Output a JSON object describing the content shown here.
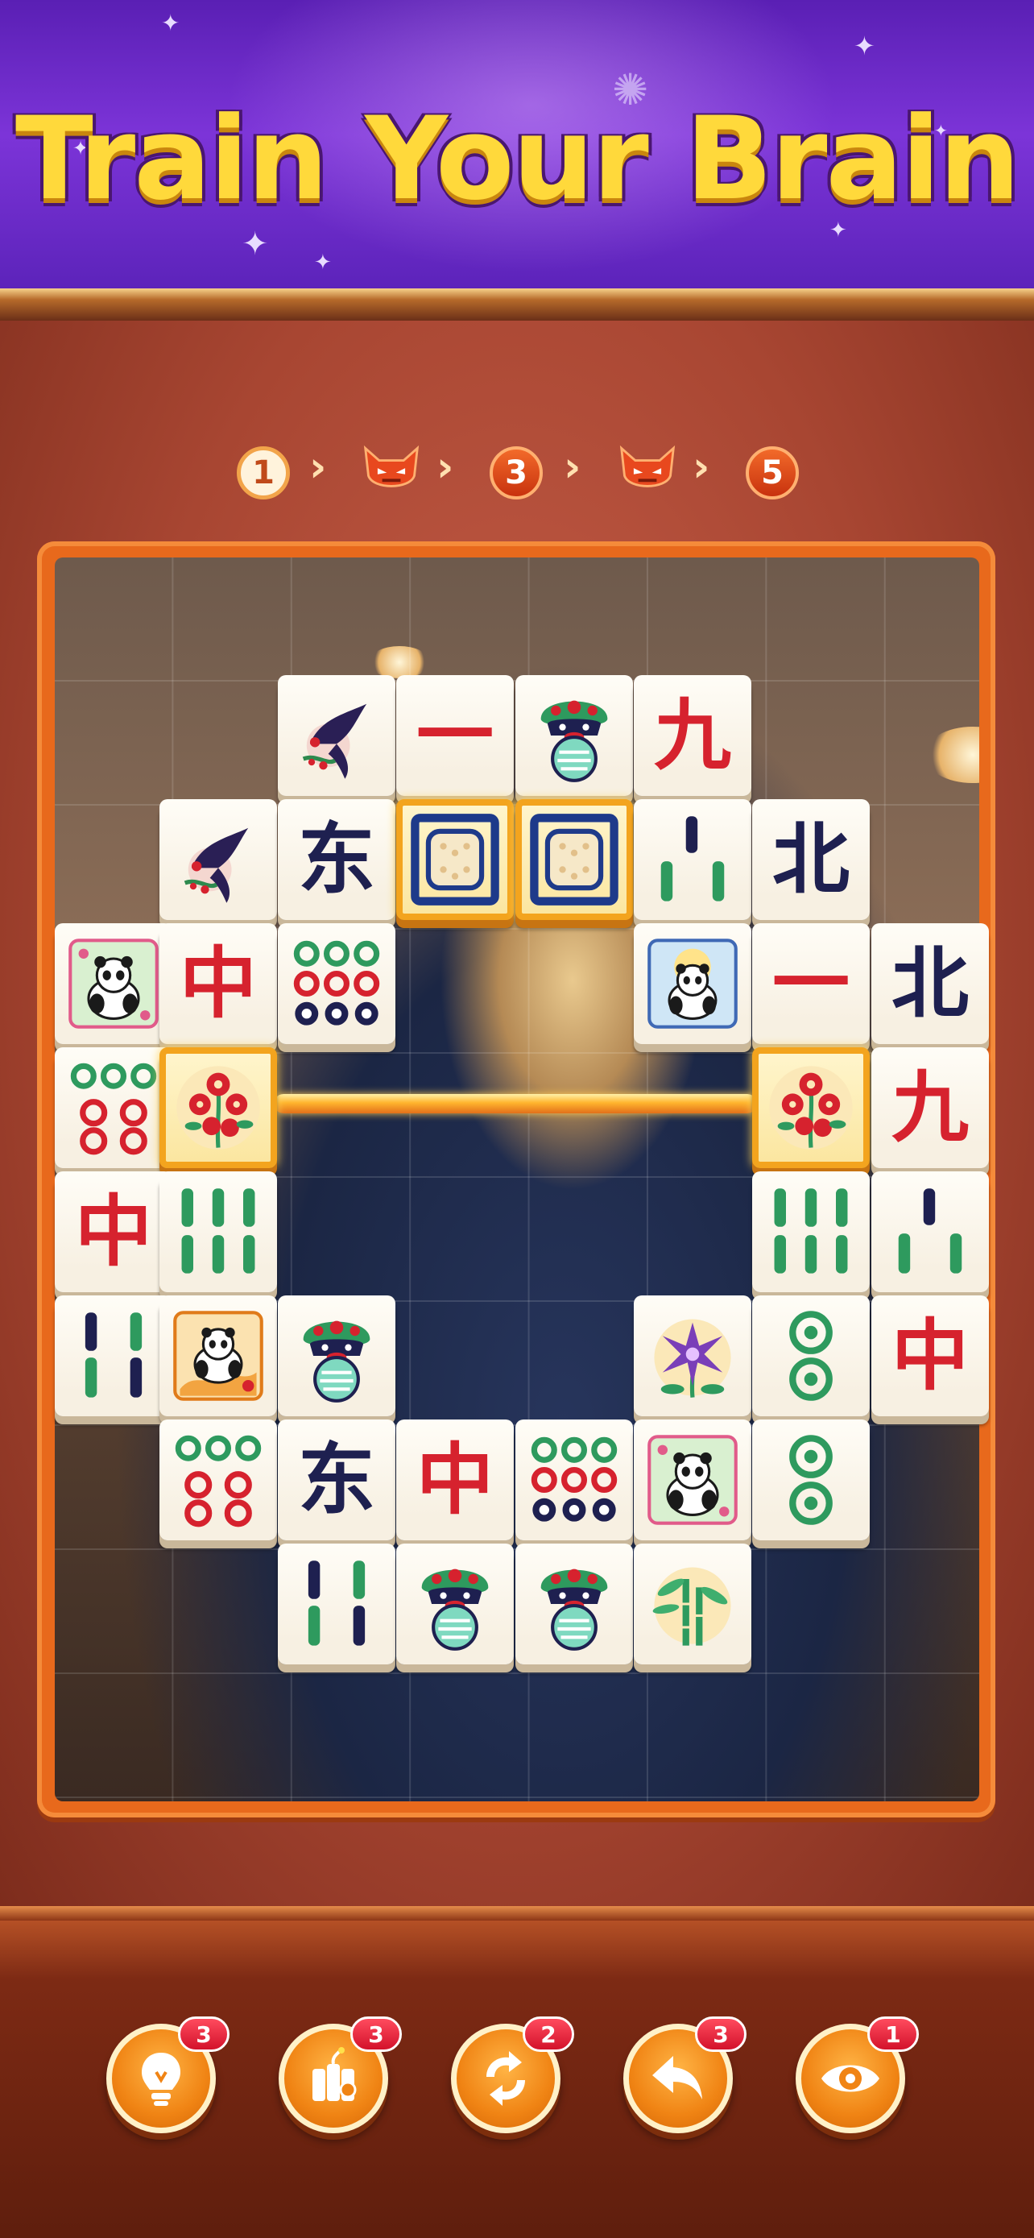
{
  "header": {
    "title": "Train Your Brain"
  },
  "level_path": {
    "nodes": [
      {
        "label": "1",
        "state": "completed"
      },
      {
        "label": "",
        "state": "boss",
        "icon": "devil-mask-icon"
      },
      {
        "label": "3",
        "state": "upcoming"
      },
      {
        "label": "",
        "state": "boss",
        "icon": "devil-mask-icon"
      },
      {
        "label": "5",
        "state": "upcoming"
      }
    ],
    "separator": "›"
  },
  "board": {
    "background": "photo-of-person-in-blazer",
    "tiles": {
      "r0c2": {
        "type": "bird"
      },
      "r0c3": {
        "type": "char",
        "text": "一",
        "color": "red"
      },
      "r0c4": {
        "type": "lion"
      },
      "r0c5": {
        "type": "char",
        "text": "九",
        "color": "red"
      },
      "r1c1": {
        "type": "bird"
      },
      "r1c2": {
        "type": "char",
        "text": "东",
        "color": "ink"
      },
      "r1c3": {
        "type": "circle-square",
        "selected": true
      },
      "r1c4": {
        "type": "circle-square",
        "selected": true
      },
      "r1c5": {
        "type": "bamboo-3"
      },
      "r1c6": {
        "type": "char",
        "text": "北",
        "color": "ink"
      },
      "r2c0": {
        "type": "panda-green"
      },
      "r2c1": {
        "type": "char",
        "text": "中",
        "color": "red"
      },
      "r2c2": {
        "type": "dots-6"
      },
      "r2c5": {
        "type": "panda-blue"
      },
      "r2c6": {
        "type": "char",
        "text": "一",
        "color": "red"
      },
      "r2c7": {
        "type": "char",
        "text": "北",
        "color": "ink"
      },
      "r3c0": {
        "type": "dots-6-red"
      },
      "r3c1": {
        "type": "flower-red",
        "selected": true
      },
      "r3c6": {
        "type": "flower-red",
        "selected": true
      },
      "r3c7": {
        "type": "char",
        "text": "九",
        "color": "red"
      },
      "r4c0": {
        "type": "char",
        "text": "中",
        "color": "red"
      },
      "r4c1": {
        "type": "bamboo-6"
      },
      "r4c6": {
        "type": "bamboo-6"
      },
      "r4c7": {
        "type": "bamboo-3"
      },
      "r5c0": {
        "type": "bamboo-4"
      },
      "r5c1": {
        "type": "panda-orange"
      },
      "r5c2": {
        "type": "lion"
      },
      "r5c5": {
        "type": "lily"
      },
      "r5c6": {
        "type": "dots-2"
      },
      "r5c7": {
        "type": "char",
        "text": "中",
        "color": "red"
      },
      "r6c1": {
        "type": "dots-6-red"
      },
      "r6c2": {
        "type": "char",
        "text": "东",
        "color": "ink"
      },
      "r6c3": {
        "type": "char",
        "text": "中",
        "color": "red"
      },
      "r6c4": {
        "type": "dots-6"
      },
      "r6c5": {
        "type": "panda-green"
      },
      "r6c6": {
        "type": "dots-2"
      },
      "r7c2": {
        "type": "bamboo-4"
      },
      "r7c3": {
        "type": "lion"
      },
      "r7c4": {
        "type": "lion"
      },
      "r7c5": {
        "type": "bamboo-plant"
      }
    }
  },
  "toolbar": {
    "items": [
      {
        "name": "hint",
        "icon": "lightbulb-icon",
        "count": "3"
      },
      {
        "name": "bomb",
        "icon": "firecracker-icon",
        "count": "3"
      },
      {
        "name": "shuffle",
        "icon": "shuffle-icon",
        "count": "2"
      },
      {
        "name": "undo",
        "icon": "undo-arrow-icon",
        "count": "3"
      },
      {
        "name": "reveal",
        "icon": "eye-icon",
        "count": "1"
      }
    ]
  },
  "colors": {
    "accent": "#f08414",
    "title": "#ffd93b",
    "banner": "#6a28c8",
    "tile_red": "#d6222e",
    "tile_ink": "#1e2050"
  }
}
